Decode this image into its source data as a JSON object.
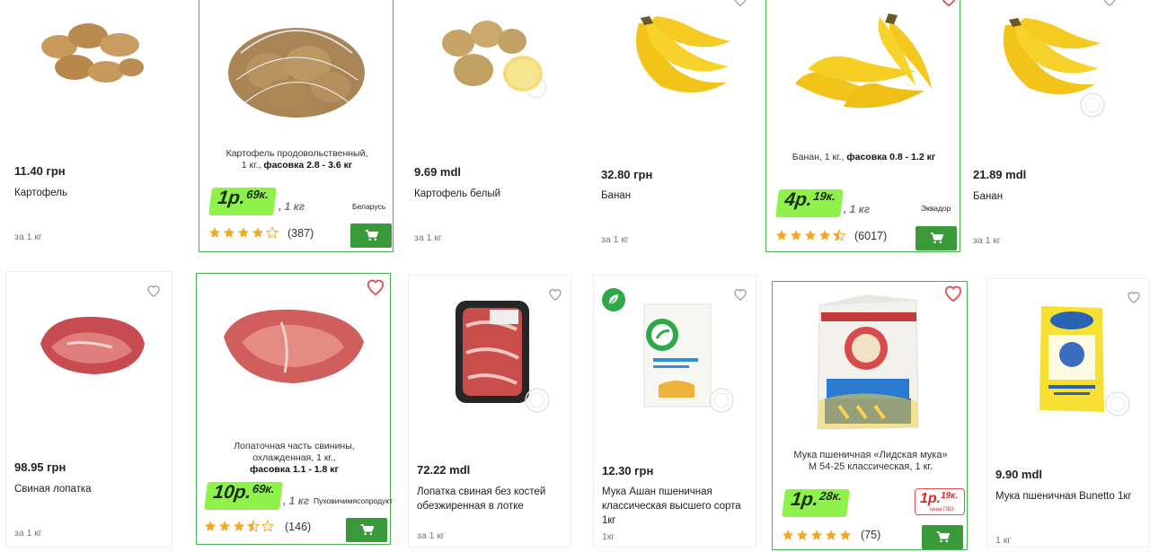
{
  "row1": {
    "c1": {
      "price": "11.40 грн",
      "name": "Картофель",
      "unit": "за 1 кг"
    },
    "c2": {
      "desc_line1": "Картофель продовольственный,",
      "desc_line2_prefix": "1 кг.,",
      "desc_line2_bold": "фасовка 2.8 - 3.6 кг",
      "price_main": "1р.",
      "price_minor": "69к.",
      "per": ", 1 кг",
      "origin": "Беларусь",
      "rating": 4,
      "reviews": "(387)"
    },
    "c3": {
      "price": "9.69 mdl",
      "name": "Картофель белый",
      "unit": "за 1 кг"
    },
    "c4": {
      "price": "32.80 грн",
      "name": "Банан",
      "unit": "за 1 кг"
    },
    "c5": {
      "desc_prefix": "Банан, 1 кг.,",
      "desc_bold": "фасовка 0.8 - 1.2 кг",
      "price_main": "4р.",
      "price_minor": "19к.",
      "per": ", 1 кг",
      "origin": "Эквадор",
      "rating": 4.5,
      "reviews": "(6017)"
    },
    "c6": {
      "price": "21.89 mdl",
      "name": "Банан",
      "unit": "за 1 кг"
    }
  },
  "row2": {
    "c1": {
      "price": "98.95 грн",
      "name": "Свиная лопатка",
      "unit": "за 1 кг"
    },
    "c2": {
      "desc_line1": "Лопаточная часть свинины,",
      "desc_line2": "охлажденная, 1 кг.,",
      "desc_line3_bold": "фасовка 1.1 - 1.8 кг",
      "price_main": "10р.",
      "price_minor": "69к.",
      "per": ", 1 кг",
      "origin": "Пуховичимясопродукт",
      "rating": 3.5,
      "reviews": "(146)"
    },
    "c3": {
      "price": "72.22 mdl",
      "name_line1": "Лопатка свиная без костей",
      "name_line2": "обезжиренная в лотке",
      "unit": "за 1 кг"
    },
    "c4": {
      "price": "12.30 грн",
      "name_line1": "Мука Ашан пшеничная",
      "name_line2": "классическая высшего сорта",
      "name_line3": "1кг",
      "unit": "1кг"
    },
    "c5": {
      "desc_line1": "Мука пшеничная «Лидская мука»",
      "desc_line2": "М 54-25 классическая, 1 кг.",
      "price_main": "1р.",
      "price_minor": "28к.",
      "old_main": "1р.",
      "old_minor": "19к.",
      "old_note": "цена ПВЗ",
      "rating": 5,
      "reviews": "(75)"
    },
    "c6": {
      "price": "9.90 mdl",
      "name": "Мука пшеничная Bunetto 1кг",
      "unit": "1 кг"
    }
  },
  "colors": {
    "accent_green": "#8ef24a",
    "cart_green": "#3a9a3a",
    "border_green": "#4caf50",
    "star": "#f5a623",
    "heart_red": "#e34f4f"
  },
  "icons": [
    "heart-icon",
    "cart-icon",
    "star-icon",
    "eco-leaf-icon",
    "watermark-icon"
  ]
}
